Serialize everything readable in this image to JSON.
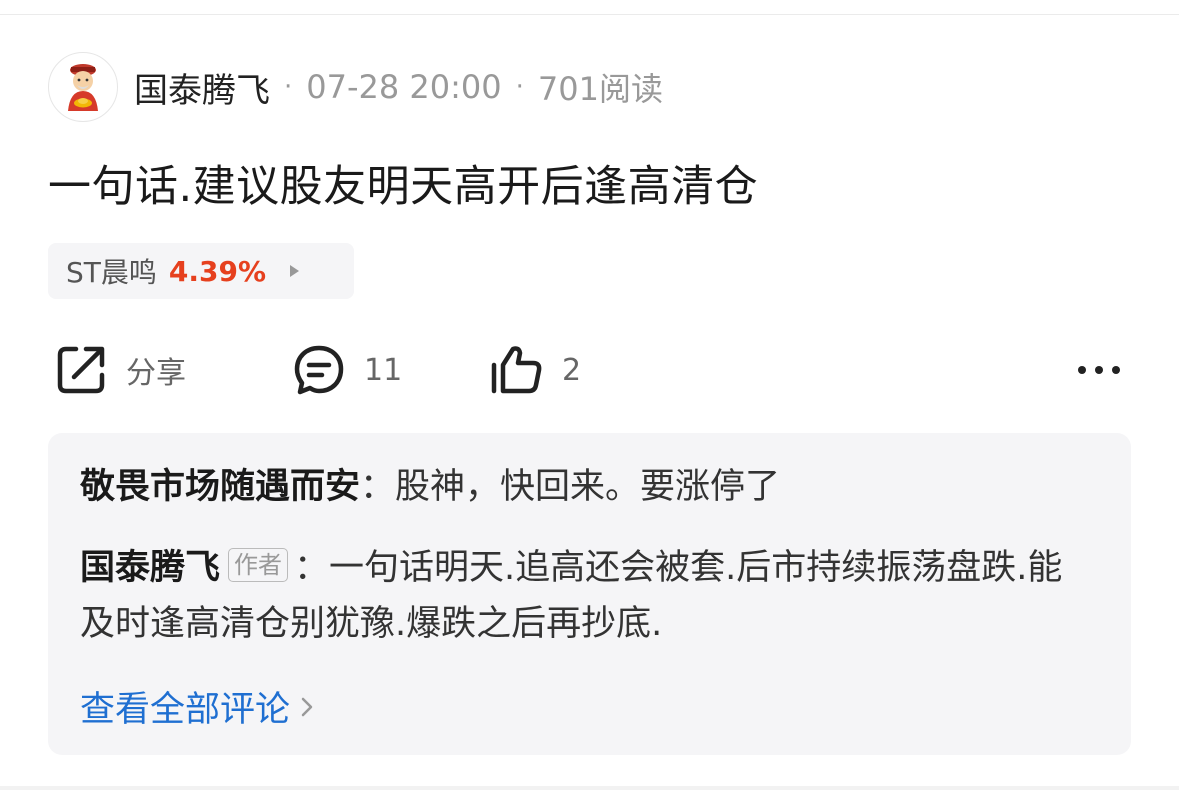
{
  "post": {
    "author": "国泰腾飞",
    "separator": "·",
    "datetime": "07-28 20:00",
    "reads": "701阅读",
    "title": "一句话.建议股友明天高开后逢高清仓"
  },
  "stock": {
    "name": "ST晨鸣",
    "change": "4.39%",
    "change_color": "#e6401e"
  },
  "actions": {
    "share_label": "分享",
    "comment_count": "11",
    "like_count": "2",
    "icons": [
      "share-icon",
      "comment-icon",
      "thumbs-up-icon",
      "more-icon"
    ]
  },
  "comments": [
    {
      "name": "敬畏市场随遇而安",
      "colon": "：",
      "text": "股神，快回来。要涨停了"
    },
    {
      "name": "国泰腾飞",
      "badge": "作者",
      "colon": "：",
      "text": "一句话明天.追高还会被套.后市持续振荡盘跌.能及时逢高清仓别犹豫.爆跌之后再抄底."
    }
  ],
  "view_all_label": "查看全部评论",
  "colors": {
    "link": "#1f6fd1",
    "panel_bg": "#f5f5f7"
  }
}
